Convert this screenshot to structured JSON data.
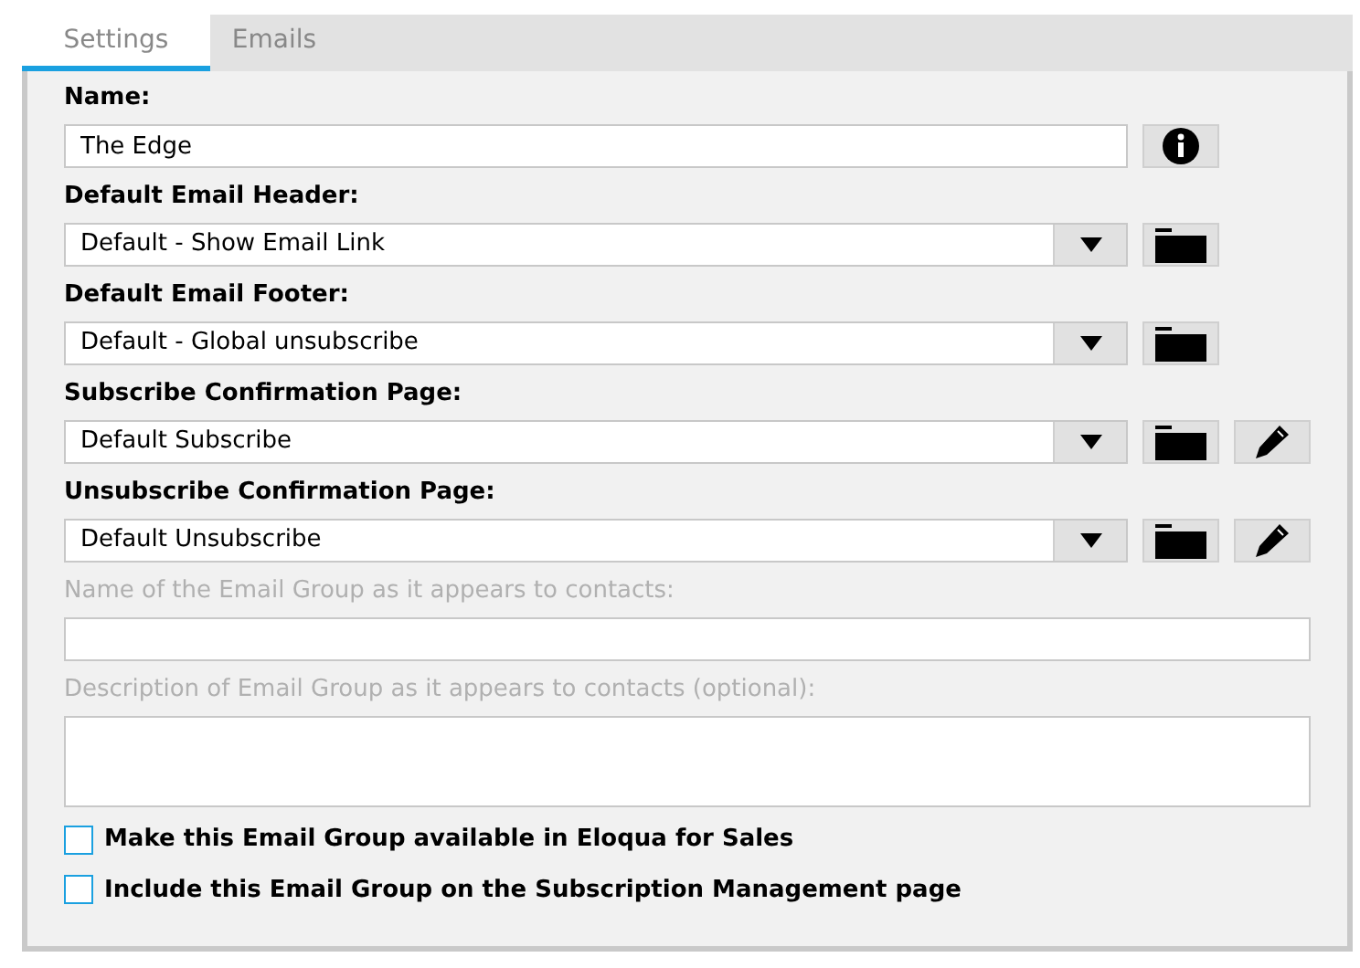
{
  "tabs": [
    {
      "label": "Settings",
      "selected": true
    },
    {
      "label": "Emails",
      "selected": false
    }
  ],
  "fields": [
    {
      "kind": "name",
      "label": "Name:",
      "value": "The Edge",
      "disabled": false
    },
    {
      "kind": "template",
      "label": "Default Email Header:",
      "value": "Default - Show Email Link",
      "disabled": false
    },
    {
      "kind": "template",
      "label": "Default Email Footer:",
      "value": "Default - Global unsubscribe",
      "disabled": false
    },
    {
      "kind": "page",
      "label": "Subscribe Confirmation Page:",
      "value": "Default Subscribe",
      "disabled": false
    },
    {
      "kind": "page",
      "label": "Unsubscribe Confirmation Page:",
      "value": "Default Unsubscribe",
      "disabled": false
    },
    {
      "kind": "text",
      "label": "Name of the Email Group as it appears to contacts:",
      "disabled": true
    },
    {
      "kind": "textarea",
      "label": "Description of Email Group as it appears to contacts (optional):",
      "disabled": true
    }
  ],
  "checkboxes": [
    {
      "label": "Make this Email Group available in Eloqua for Sales",
      "checked": false
    },
    {
      "label": "Include this Email Group on the Subscription Management page",
      "checked": false
    }
  ]
}
